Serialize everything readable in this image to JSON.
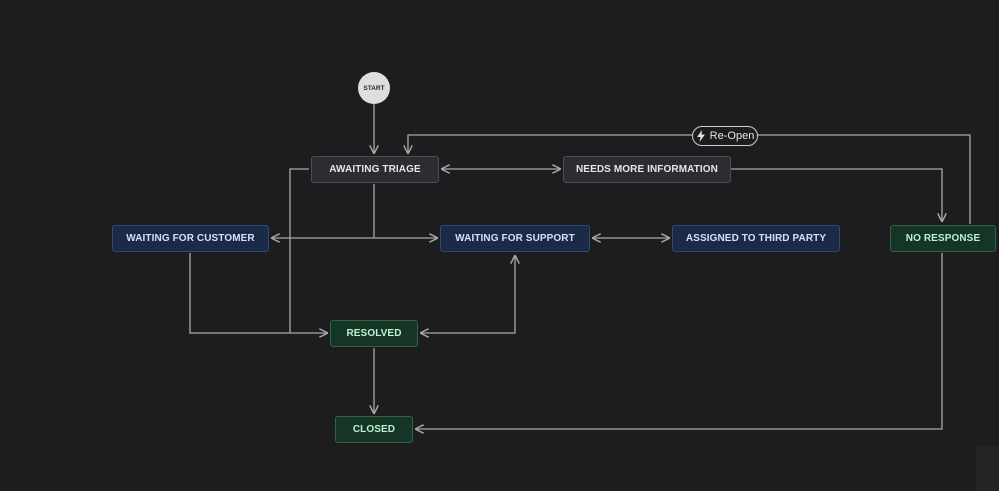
{
  "start_label": "START",
  "transition_label": "Re-Open",
  "transition_icon": "lightning-icon",
  "statuses": {
    "awaiting_triage": "AWAITING TRIAGE",
    "needs_more_information": "NEEDS MORE INFORMATION",
    "waiting_for_customer": "WAITING FOR CUSTOMER",
    "waiting_for_support": "WAITING FOR SUPPORT",
    "assigned_to_third_party": "ASSIGNED TO THIRD PARTY",
    "no_response": "NO RESPONSE",
    "resolved": "RESOLVED",
    "closed": "CLOSED"
  },
  "colors": {
    "background": "#1d1d1f",
    "edge": "#a8a8a8",
    "todo": "#2c2d30",
    "in_progress": "#1b2a45",
    "done": "#163526"
  }
}
